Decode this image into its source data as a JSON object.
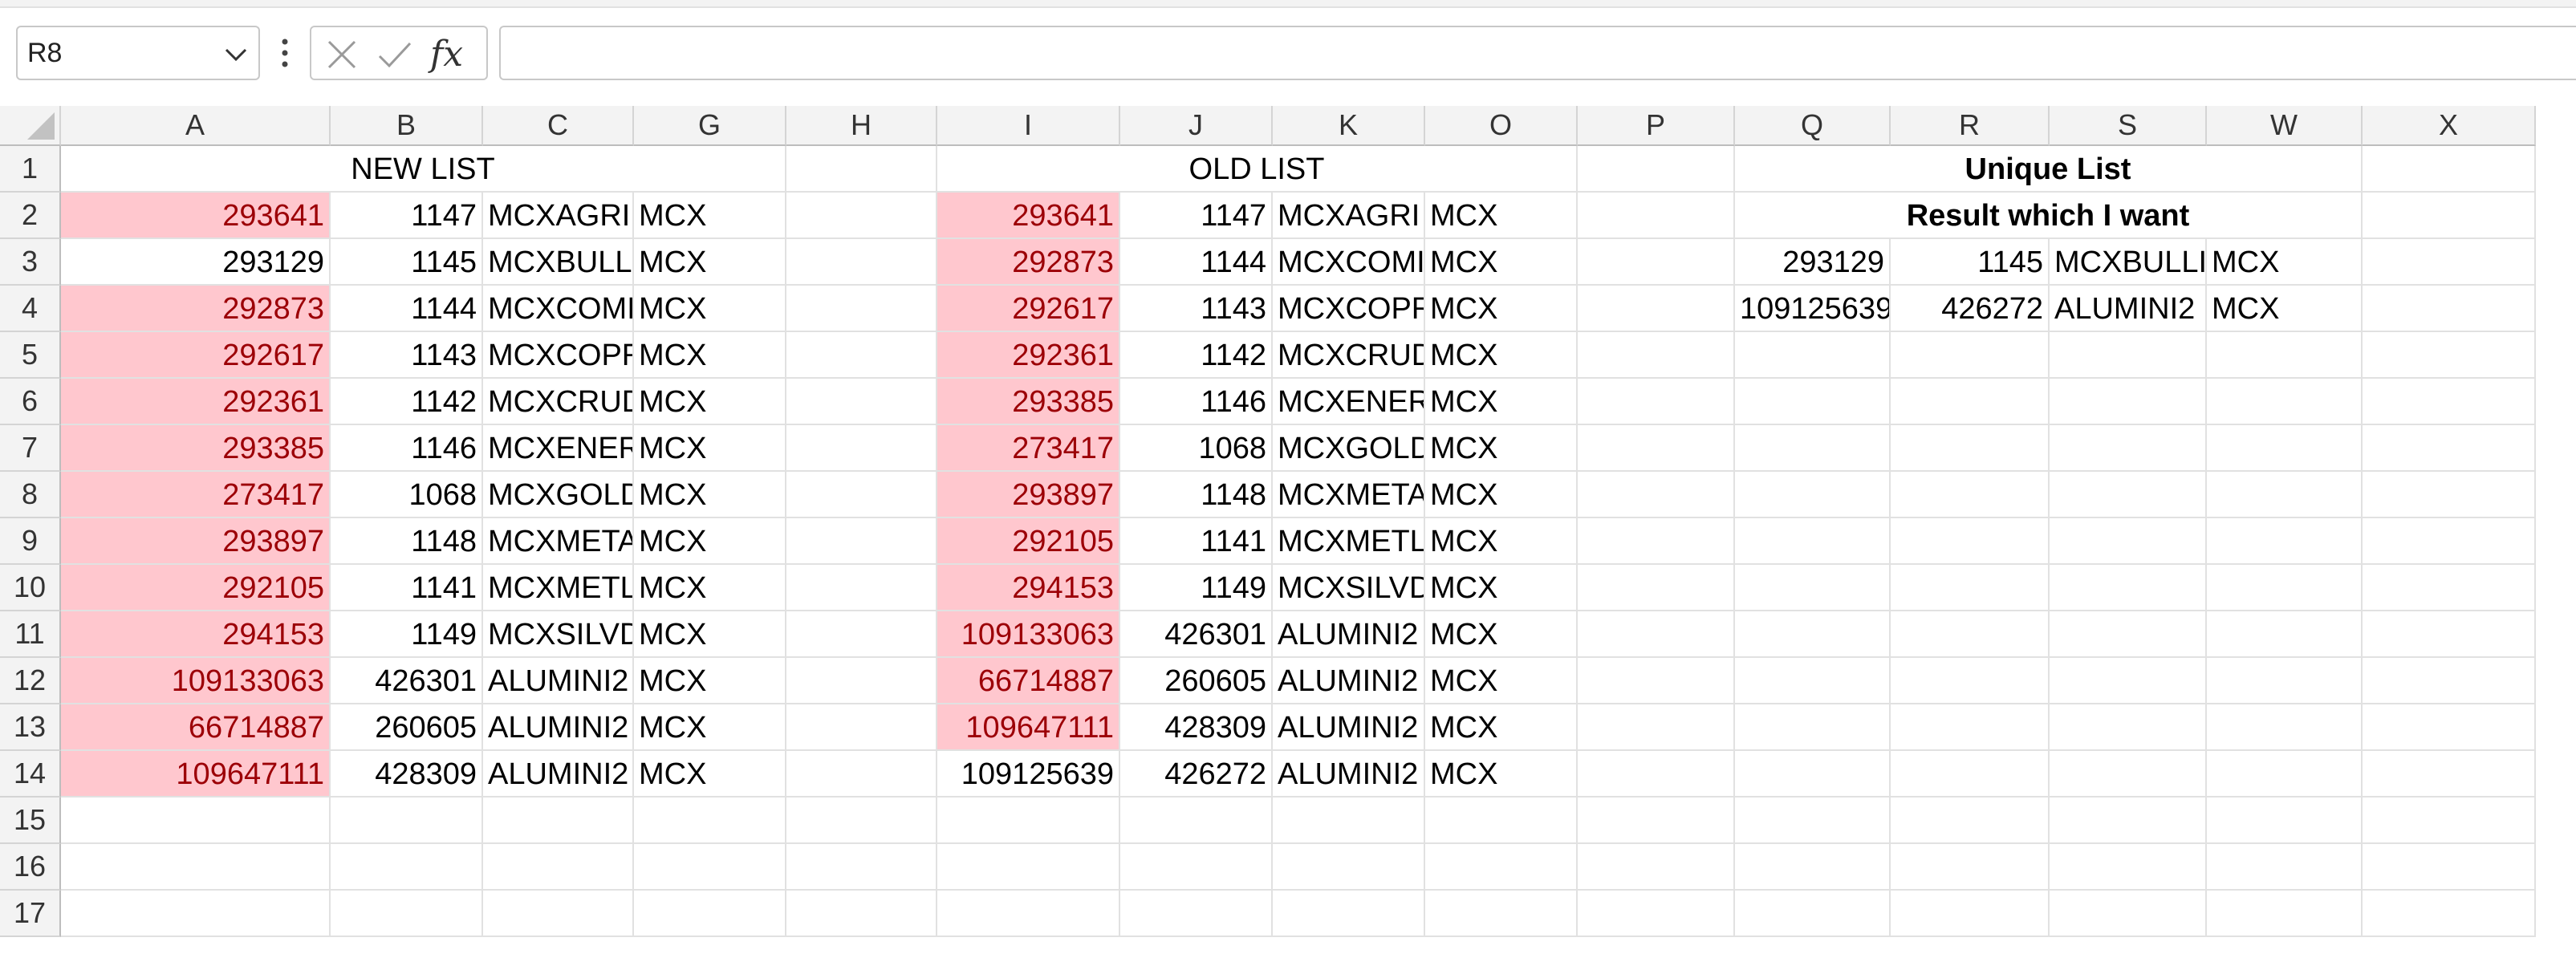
{
  "toolbar": {
    "name_box": "R8",
    "formula": "",
    "fx_label": "fx"
  },
  "sheet": {
    "columns": [
      "A",
      "B",
      "C",
      "G",
      "H",
      "I",
      "J",
      "K",
      "O",
      "P",
      "Q",
      "R",
      "S",
      "W",
      "X"
    ],
    "rows": [
      "1",
      "2",
      "3",
      "4",
      "5",
      "6",
      "7",
      "8",
      "9",
      "10",
      "11",
      "12",
      "13",
      "14",
      "15",
      "16",
      "17"
    ],
    "titles": {
      "new_list": "NEW LIST",
      "old_list": "OLD LIST",
      "unique_list": "Unique List",
      "result_label": "Result which I want"
    },
    "new_list": [
      {
        "a": "293641",
        "b": "1147",
        "c": "MCXAGRI",
        "g": "MCX",
        "highlight": true
      },
      {
        "a": "293129",
        "b": "1145",
        "c": "MCXBULLI",
        "g": "MCX",
        "highlight": false
      },
      {
        "a": "292873",
        "b": "1144",
        "c": "MCXCOMI",
        "g": "MCX",
        "highlight": true
      },
      {
        "a": "292617",
        "b": "1143",
        "c": "MCXCOPR",
        "g": "MCX",
        "highlight": true
      },
      {
        "a": "292361",
        "b": "1142",
        "c": "MCXCRUD",
        "g": "MCX",
        "highlight": true
      },
      {
        "a": "293385",
        "b": "1146",
        "c": "MCXENER",
        "g": "MCX",
        "highlight": true
      },
      {
        "a": "273417",
        "b": "1068",
        "c": "MCXGOLD",
        "g": "MCX",
        "highlight": true
      },
      {
        "a": "293897",
        "b": "1148",
        "c": "MCXMETA",
        "g": "MCX",
        "highlight": true
      },
      {
        "a": "292105",
        "b": "1141",
        "c": "MCXMETL",
        "g": "MCX",
        "highlight": true
      },
      {
        "a": "294153",
        "b": "1149",
        "c": "MCXSILVD",
        "g": "MCX",
        "highlight": true
      },
      {
        "a": "109133063",
        "b": "426301",
        "c": "ALUMINI2",
        "g": "MCX",
        "highlight": true
      },
      {
        "a": "66714887",
        "b": "260605",
        "c": "ALUMINI2",
        "g": "MCX",
        "highlight": true
      },
      {
        "a": "109647111",
        "b": "428309",
        "c": "ALUMINI2",
        "g": "MCX",
        "highlight": true
      }
    ],
    "old_list": [
      {
        "i": "293641",
        "j": "1147",
        "k": "MCXAGRI",
        "o": "MCX",
        "highlight": true
      },
      {
        "i": "292873",
        "j": "1144",
        "k": "MCXCOMI",
        "o": "MCX",
        "highlight": true
      },
      {
        "i": "292617",
        "j": "1143",
        "k": "MCXCOPR",
        "o": "MCX",
        "highlight": true
      },
      {
        "i": "292361",
        "j": "1142",
        "k": "MCXCRUD",
        "o": "MCX",
        "highlight": true
      },
      {
        "i": "293385",
        "j": "1146",
        "k": "MCXENER",
        "o": "MCX",
        "highlight": true
      },
      {
        "i": "273417",
        "j": "1068",
        "k": "MCXGOLD",
        "o": "MCX",
        "highlight": true
      },
      {
        "i": "293897",
        "j": "1148",
        "k": "MCXMETA",
        "o": "MCX",
        "highlight": true
      },
      {
        "i": "292105",
        "j": "1141",
        "k": "MCXMETL",
        "o": "MCX",
        "highlight": true
      },
      {
        "i": "294153",
        "j": "1149",
        "k": "MCXSILVD",
        "o": "MCX",
        "highlight": true
      },
      {
        "i": "109133063",
        "j": "426301",
        "k": "ALUMINI2",
        "o": "MCX",
        "highlight": true
      },
      {
        "i": "66714887",
        "j": "260605",
        "k": "ALUMINI2",
        "o": "MCX",
        "highlight": true
      },
      {
        "i": "109647111",
        "j": "428309",
        "k": "ALUMINI2",
        "o": "MCX",
        "highlight": true
      },
      {
        "i": "109125639",
        "j": "426272",
        "k": "ALUMINI2",
        "o": "MCX",
        "highlight": false
      }
    ],
    "result": [
      {
        "q": "293129",
        "r": "1145",
        "s": "MCXBULLI",
        "w": "MCX"
      },
      {
        "q": "109125639",
        "r": "426272",
        "s": "ALUMINI2",
        "w": "MCX"
      }
    ]
  },
  "colors": {
    "highlight_fill": "#ffc7ce",
    "highlight_text": "#9c0006",
    "header_bg": "#f3f3f3",
    "gridline": "#e1e1e1"
  }
}
